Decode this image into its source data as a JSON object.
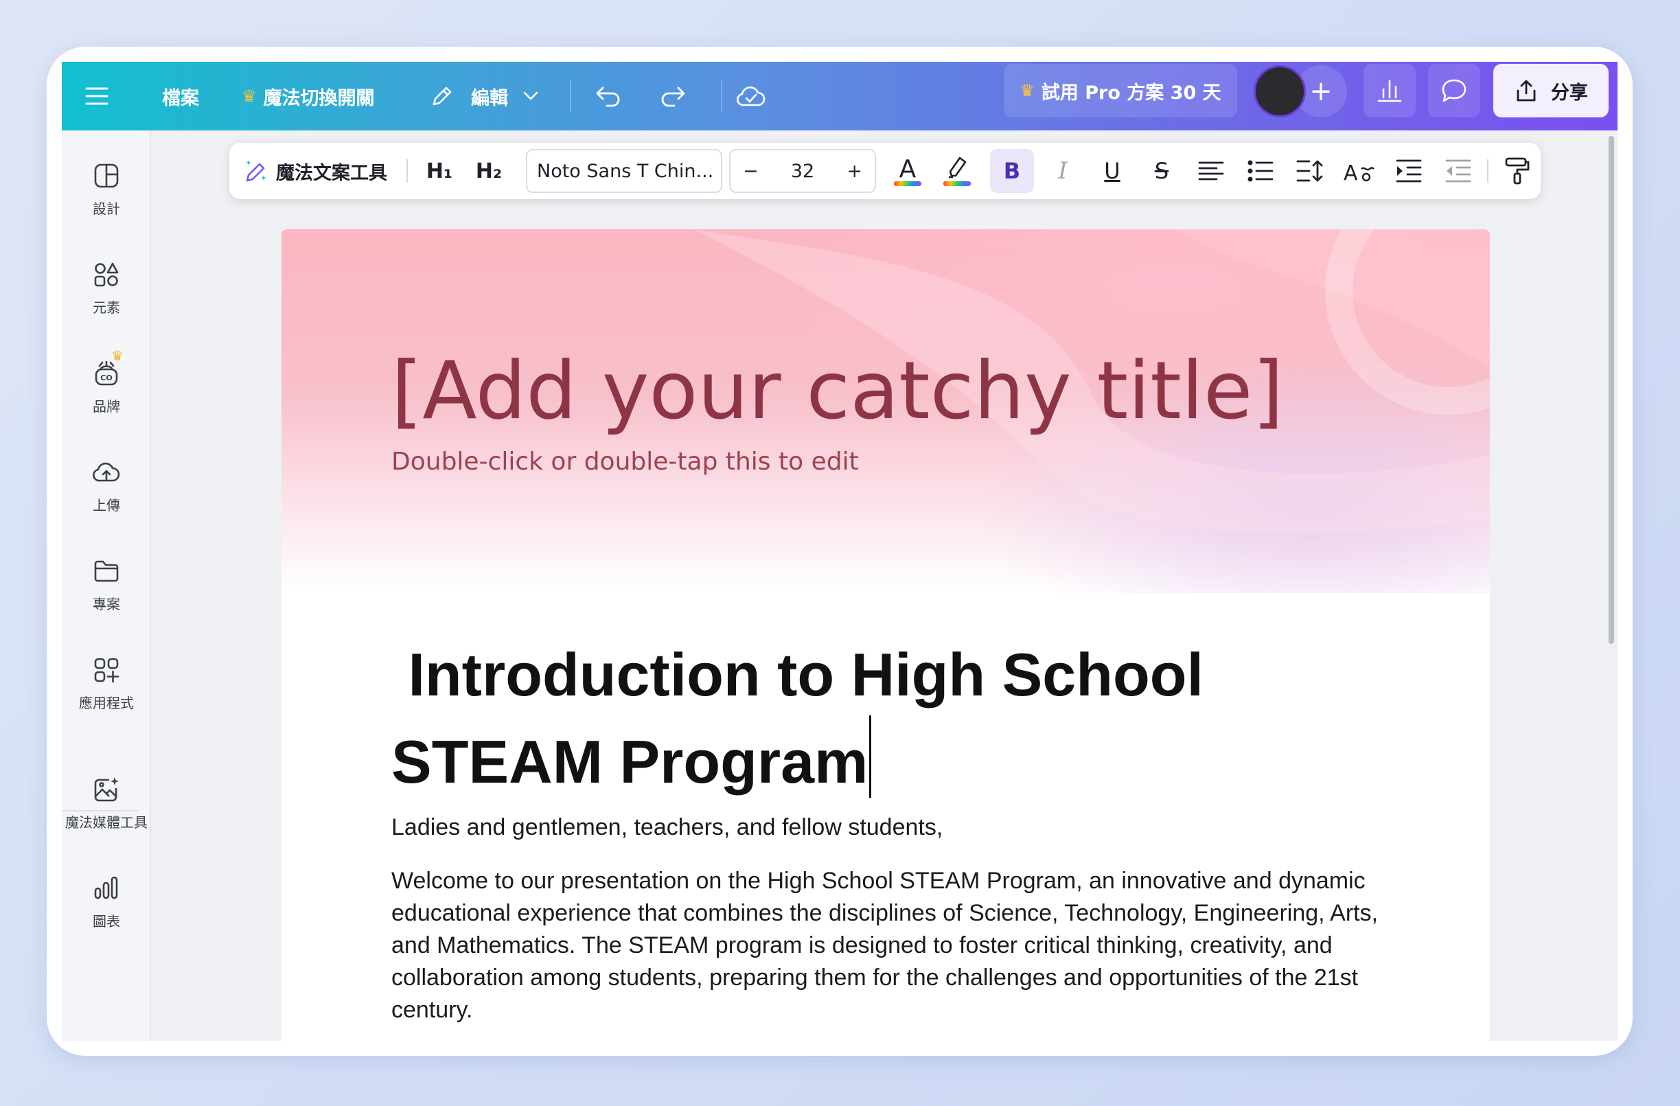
{
  "topbar": {
    "file": "檔案",
    "magic_switch": "魔法切換開關",
    "edit": "編輯",
    "try_pro": "試用 Pro 方案 30 天",
    "share": "分享"
  },
  "sidebar": {
    "items": [
      {
        "label": "設計",
        "icon": "design-icon"
      },
      {
        "label": "元素",
        "icon": "elements-icon"
      },
      {
        "label": "品牌",
        "icon": "brand-icon"
      },
      {
        "label": "上傳",
        "icon": "upload-icon"
      },
      {
        "label": "專案",
        "icon": "folder-icon"
      },
      {
        "label": "應用程式",
        "icon": "apps-icon"
      },
      {
        "label": "魔法媒體工具",
        "icon": "magic-media-icon"
      },
      {
        "label": "圖表",
        "icon": "charts-icon"
      }
    ]
  },
  "text_toolbar": {
    "magic_write": "魔法文案工具",
    "h1": "H₁",
    "h2": "H₂",
    "font": "Noto Sans T Chin...",
    "size_minus": "−",
    "size": "32",
    "size_plus": "+",
    "bold": "B",
    "italic": "I",
    "underline": "U",
    "strike": "S"
  },
  "document": {
    "hero_title": "[Add your catchy title]",
    "hero_subtitle": "Double-click or double-tap this to edit",
    "heading_line1": " Introduction to High School",
    "heading_line2": "STEAM Program",
    "para1": "Ladies and gentlemen, teachers, and fellow students,",
    "para2_lines": [
      "Welcome to our presentation on the High School STEAM Program, an innovative and dynamic",
      "educational experience that combines the disciplines of Science, Technology, Engineering, Arts,",
      "and Mathematics. The STEAM program is designed to foster critical thinking, creativity, and",
      "collaboration among students, preparing them for the challenges and opportunities of the 21st",
      "century."
    ]
  },
  "colors": {
    "topbar_start": "#12bfcf",
    "topbar_end": "#7b4ff0",
    "hero_title": "#8e3545",
    "pro_crown": "#ffc23a"
  }
}
